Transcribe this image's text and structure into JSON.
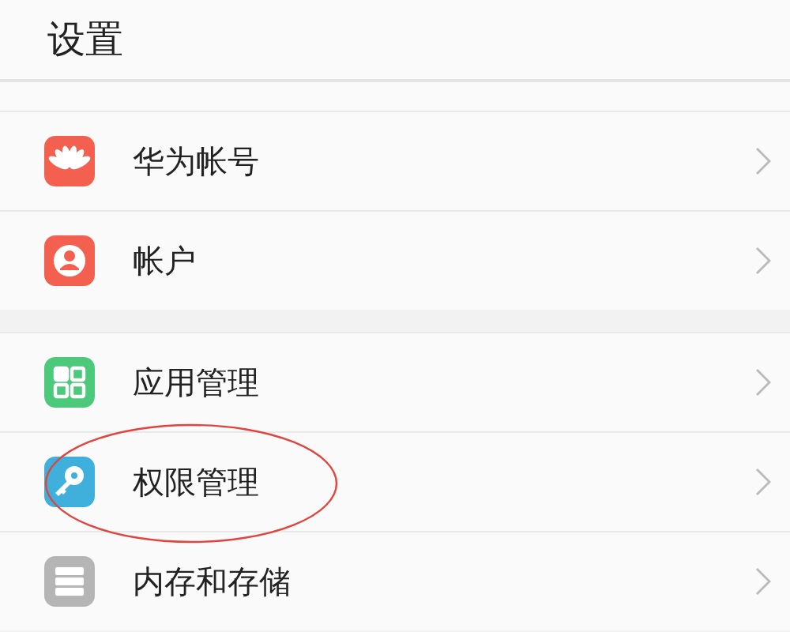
{
  "title": "设置",
  "groups": [
    {
      "items": [
        {
          "label": "华为帐号",
          "kind": "petals",
          "color": "#f4604f",
          "circled": false
        },
        {
          "label": "帐户",
          "kind": "person",
          "color": "#f4604f",
          "circled": false
        }
      ]
    },
    {
      "items": [
        {
          "label": "应用管理",
          "kind": "grid",
          "color": "#4cc97a",
          "circled": false
        },
        {
          "label": "权限管理",
          "kind": "key",
          "color": "#3fb0dc",
          "circled": true
        },
        {
          "label": "内存和存储",
          "kind": "storage",
          "color": "#b5b5b5",
          "circled": false
        }
      ]
    }
  ]
}
